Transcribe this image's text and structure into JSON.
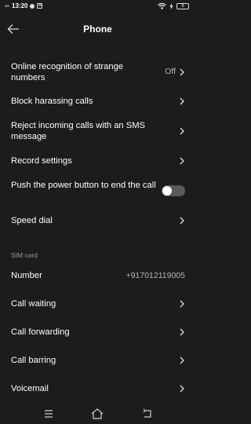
{
  "status": {
    "network": "4G",
    "time": "13:20",
    "battery": "9"
  },
  "header": {
    "title": "Phone"
  },
  "settings": [
    {
      "label": "Online recognition of strange numbers",
      "value": "Off"
    },
    {
      "label": "Block harassing calls"
    },
    {
      "label": "Reject incoming calls with an SMS message"
    },
    {
      "label": "Record settings"
    },
    {
      "label": "Push the power button to end the call",
      "toggle": false
    },
    {
      "label": "Speed dial"
    }
  ],
  "sim": {
    "section_label": "SIM card",
    "items": [
      {
        "label": "Number",
        "value": "+917012119005"
      },
      {
        "label": "Call waiting"
      },
      {
        "label": "Call forwarding"
      },
      {
        "label": "Call barring"
      },
      {
        "label": "Voicemail"
      }
    ]
  },
  "colors": {
    "background": "#1c1c1c",
    "text": "#ffffff",
    "secondary": "#9a9a9a",
    "toggle_off": "#5a5a5a"
  }
}
